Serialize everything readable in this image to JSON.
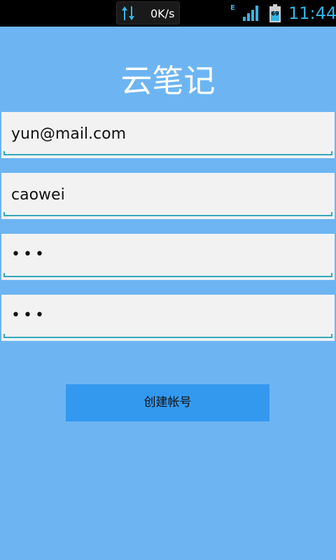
{
  "status_bar": {
    "netspeed": "0K/s",
    "network_type": "E",
    "battery_level": "69",
    "time": "11:44"
  },
  "app": {
    "title": "云笔记"
  },
  "form": {
    "email": "yun@mail.com",
    "username": "caowei",
    "password": "•••",
    "confirm_password": "•••",
    "submit_label": "创建帐号"
  },
  "colors": {
    "background": "#6db5f2",
    "button": "#3399ef",
    "field": "#f2f2f2",
    "underline": "#33a7bc",
    "status_accent": "#33b5e5"
  }
}
